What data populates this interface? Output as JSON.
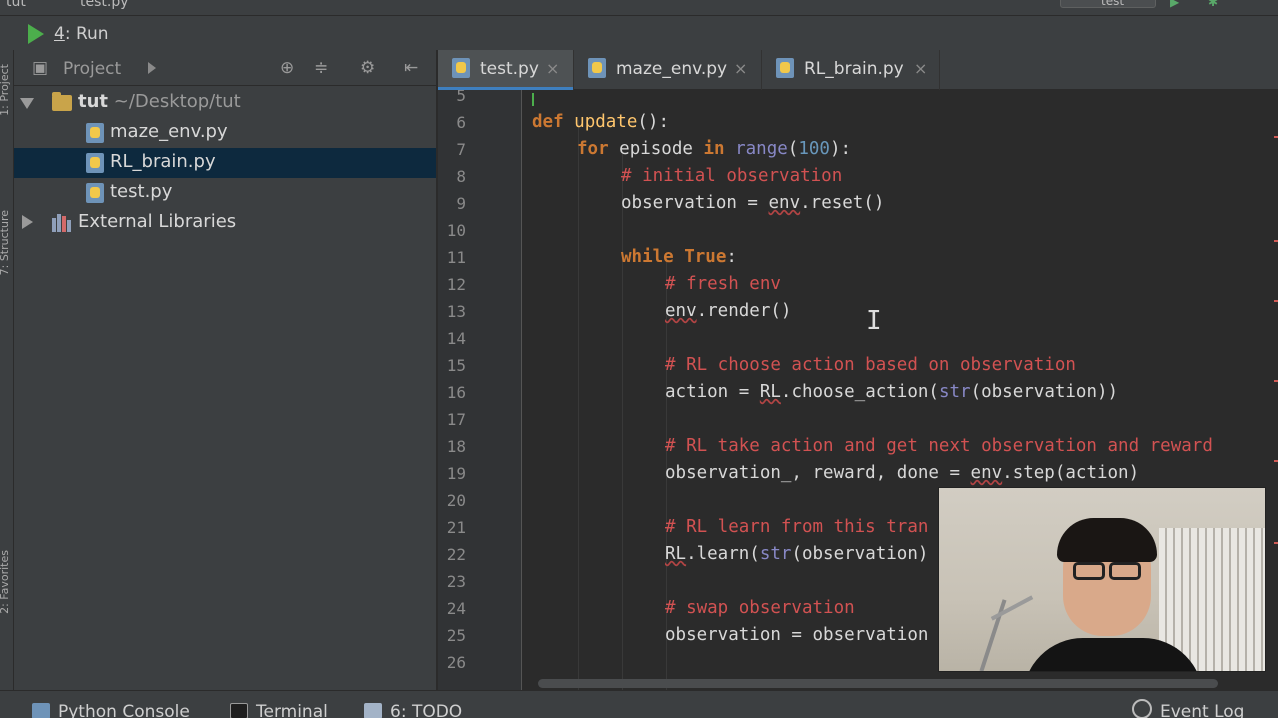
{
  "window": {
    "crumb_project": "tut",
    "crumb_file": "test.py",
    "run_config": "test"
  },
  "runbar": {
    "key": "4",
    "label": ": Run"
  },
  "left_strip": {
    "project": "1: Project",
    "structure": "7: Structure",
    "favorites": "2: Favorites"
  },
  "project_panel": {
    "title": "Project",
    "tree": [
      {
        "name": "tut",
        "suffix": "~/Desktop/tut",
        "type": "folder",
        "expanded": true
      },
      {
        "name": "maze_env.py",
        "type": "python-file"
      },
      {
        "name": "RL_brain.py",
        "type": "python-file",
        "selected": true
      },
      {
        "name": "test.py",
        "type": "python-file"
      },
      {
        "name": "External Libraries",
        "type": "libraries",
        "expanded": false
      }
    ]
  },
  "tabs": [
    {
      "label": "test.py",
      "active": true,
      "close": "×"
    },
    {
      "label": "maze_env.py",
      "active": false,
      "close": "×"
    },
    {
      "label": "RL_brain.py",
      "active": false,
      "close": "×"
    }
  ],
  "editor": {
    "lines": [
      "5",
      "6",
      "7",
      "8",
      "9",
      "10",
      "11",
      "12",
      "13",
      "14",
      "15",
      "16",
      "17",
      "18",
      "19",
      "20",
      "21",
      "22",
      "23",
      "24",
      "25",
      "26"
    ],
    "code": {
      "l6": {
        "kw": "def",
        "fn": "update",
        "rest": "():"
      },
      "l7": {
        "kw_for": "for",
        "var": "episode",
        "kw_in": "in",
        "bi": "range",
        "num": "100",
        "rest": "):"
      },
      "l8": "# initial observation",
      "l9": {
        "a": "observation = ",
        "u": "env",
        "b": ".reset()"
      },
      "l11": {
        "kw": "while",
        "kc": "True",
        "rest": ":"
      },
      "l12": "# fresh env",
      "l13": {
        "u": "env",
        "b": ".render()"
      },
      "l15": "# RL choose action based on observation",
      "l16": {
        "a": "action = ",
        "u": "RL",
        "b": ".choose_action(",
        "bi": "str",
        "c": "(observation))"
      },
      "l18": "# RL take action and get next observation and reward",
      "l19": {
        "a": "observation_, reward, done = ",
        "u": "env",
        "b": ".step(action)"
      },
      "l21": "# RL learn from this tran",
      "l22": {
        "u": "RL",
        "b": ".learn(",
        "bi": "str",
        "c": "(observation)"
      },
      "l24": "# swap observation",
      "l25": "observation = observation"
    }
  },
  "bottom_tools": [
    {
      "label": "Python Console",
      "icon": "python-icon"
    },
    {
      "label": "Terminal",
      "icon": "terminal-icon"
    },
    {
      "label": "6: TODO",
      "icon": "todo-icon"
    },
    {
      "label": "Event Log",
      "icon": "event-log-icon"
    }
  ],
  "colors": {
    "keyword": "#cc7832",
    "function": "#ffc66d",
    "builtin": "#8888c6",
    "number": "#6897bb",
    "comment": "#d25252",
    "selection": "#0d293e",
    "accent": "#3e7fbf"
  }
}
